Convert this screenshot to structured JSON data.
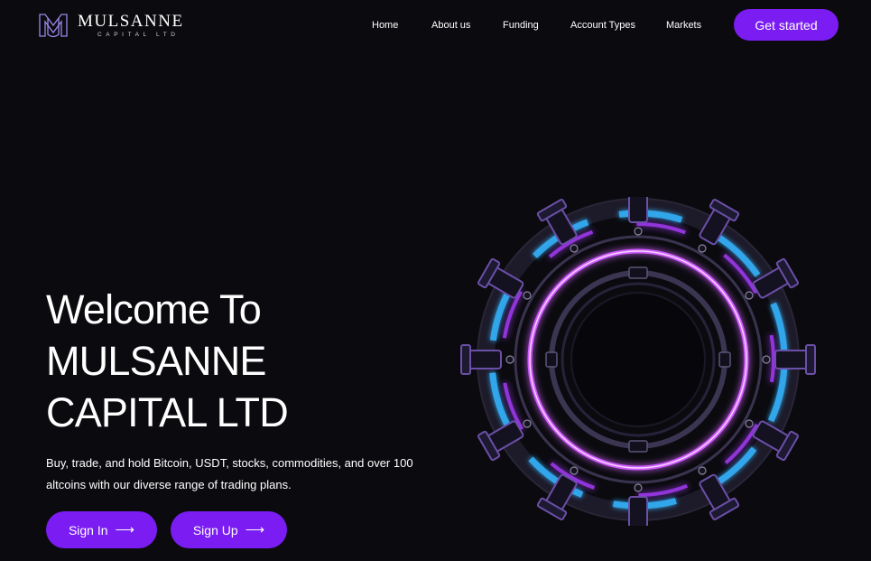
{
  "header": {
    "logo": {
      "name": "MULSANNE",
      "sub": "CAPITAL LTD",
      "icon": "mulsanne-monogram-icon"
    },
    "nav": [
      {
        "label": "Home"
      },
      {
        "label": "About us"
      },
      {
        "label": "Funding"
      },
      {
        "label": "Account Types"
      },
      {
        "label": "Markets"
      }
    ],
    "cta_label": "Get started"
  },
  "hero": {
    "title_lines": [
      "Welcome To",
      "MULSANNE",
      "CAPITAL LTD"
    ],
    "description": "Buy, trade, and hold Bitcoin, USDT, stocks, commodities, and over 100 altcoins with our diverse range of trading plans.",
    "buttons": {
      "sign_in": "Sign In",
      "sign_up": "Sign Up",
      "arrow_icon": "arrow-right-icon"
    },
    "illustration": "neon-portal-ring"
  },
  "colors": {
    "background": "#0b0b0f",
    "accent": "#7a1cf2",
    "glow_purple": "#c44dff",
    "glow_cyan": "#35b6ff"
  }
}
